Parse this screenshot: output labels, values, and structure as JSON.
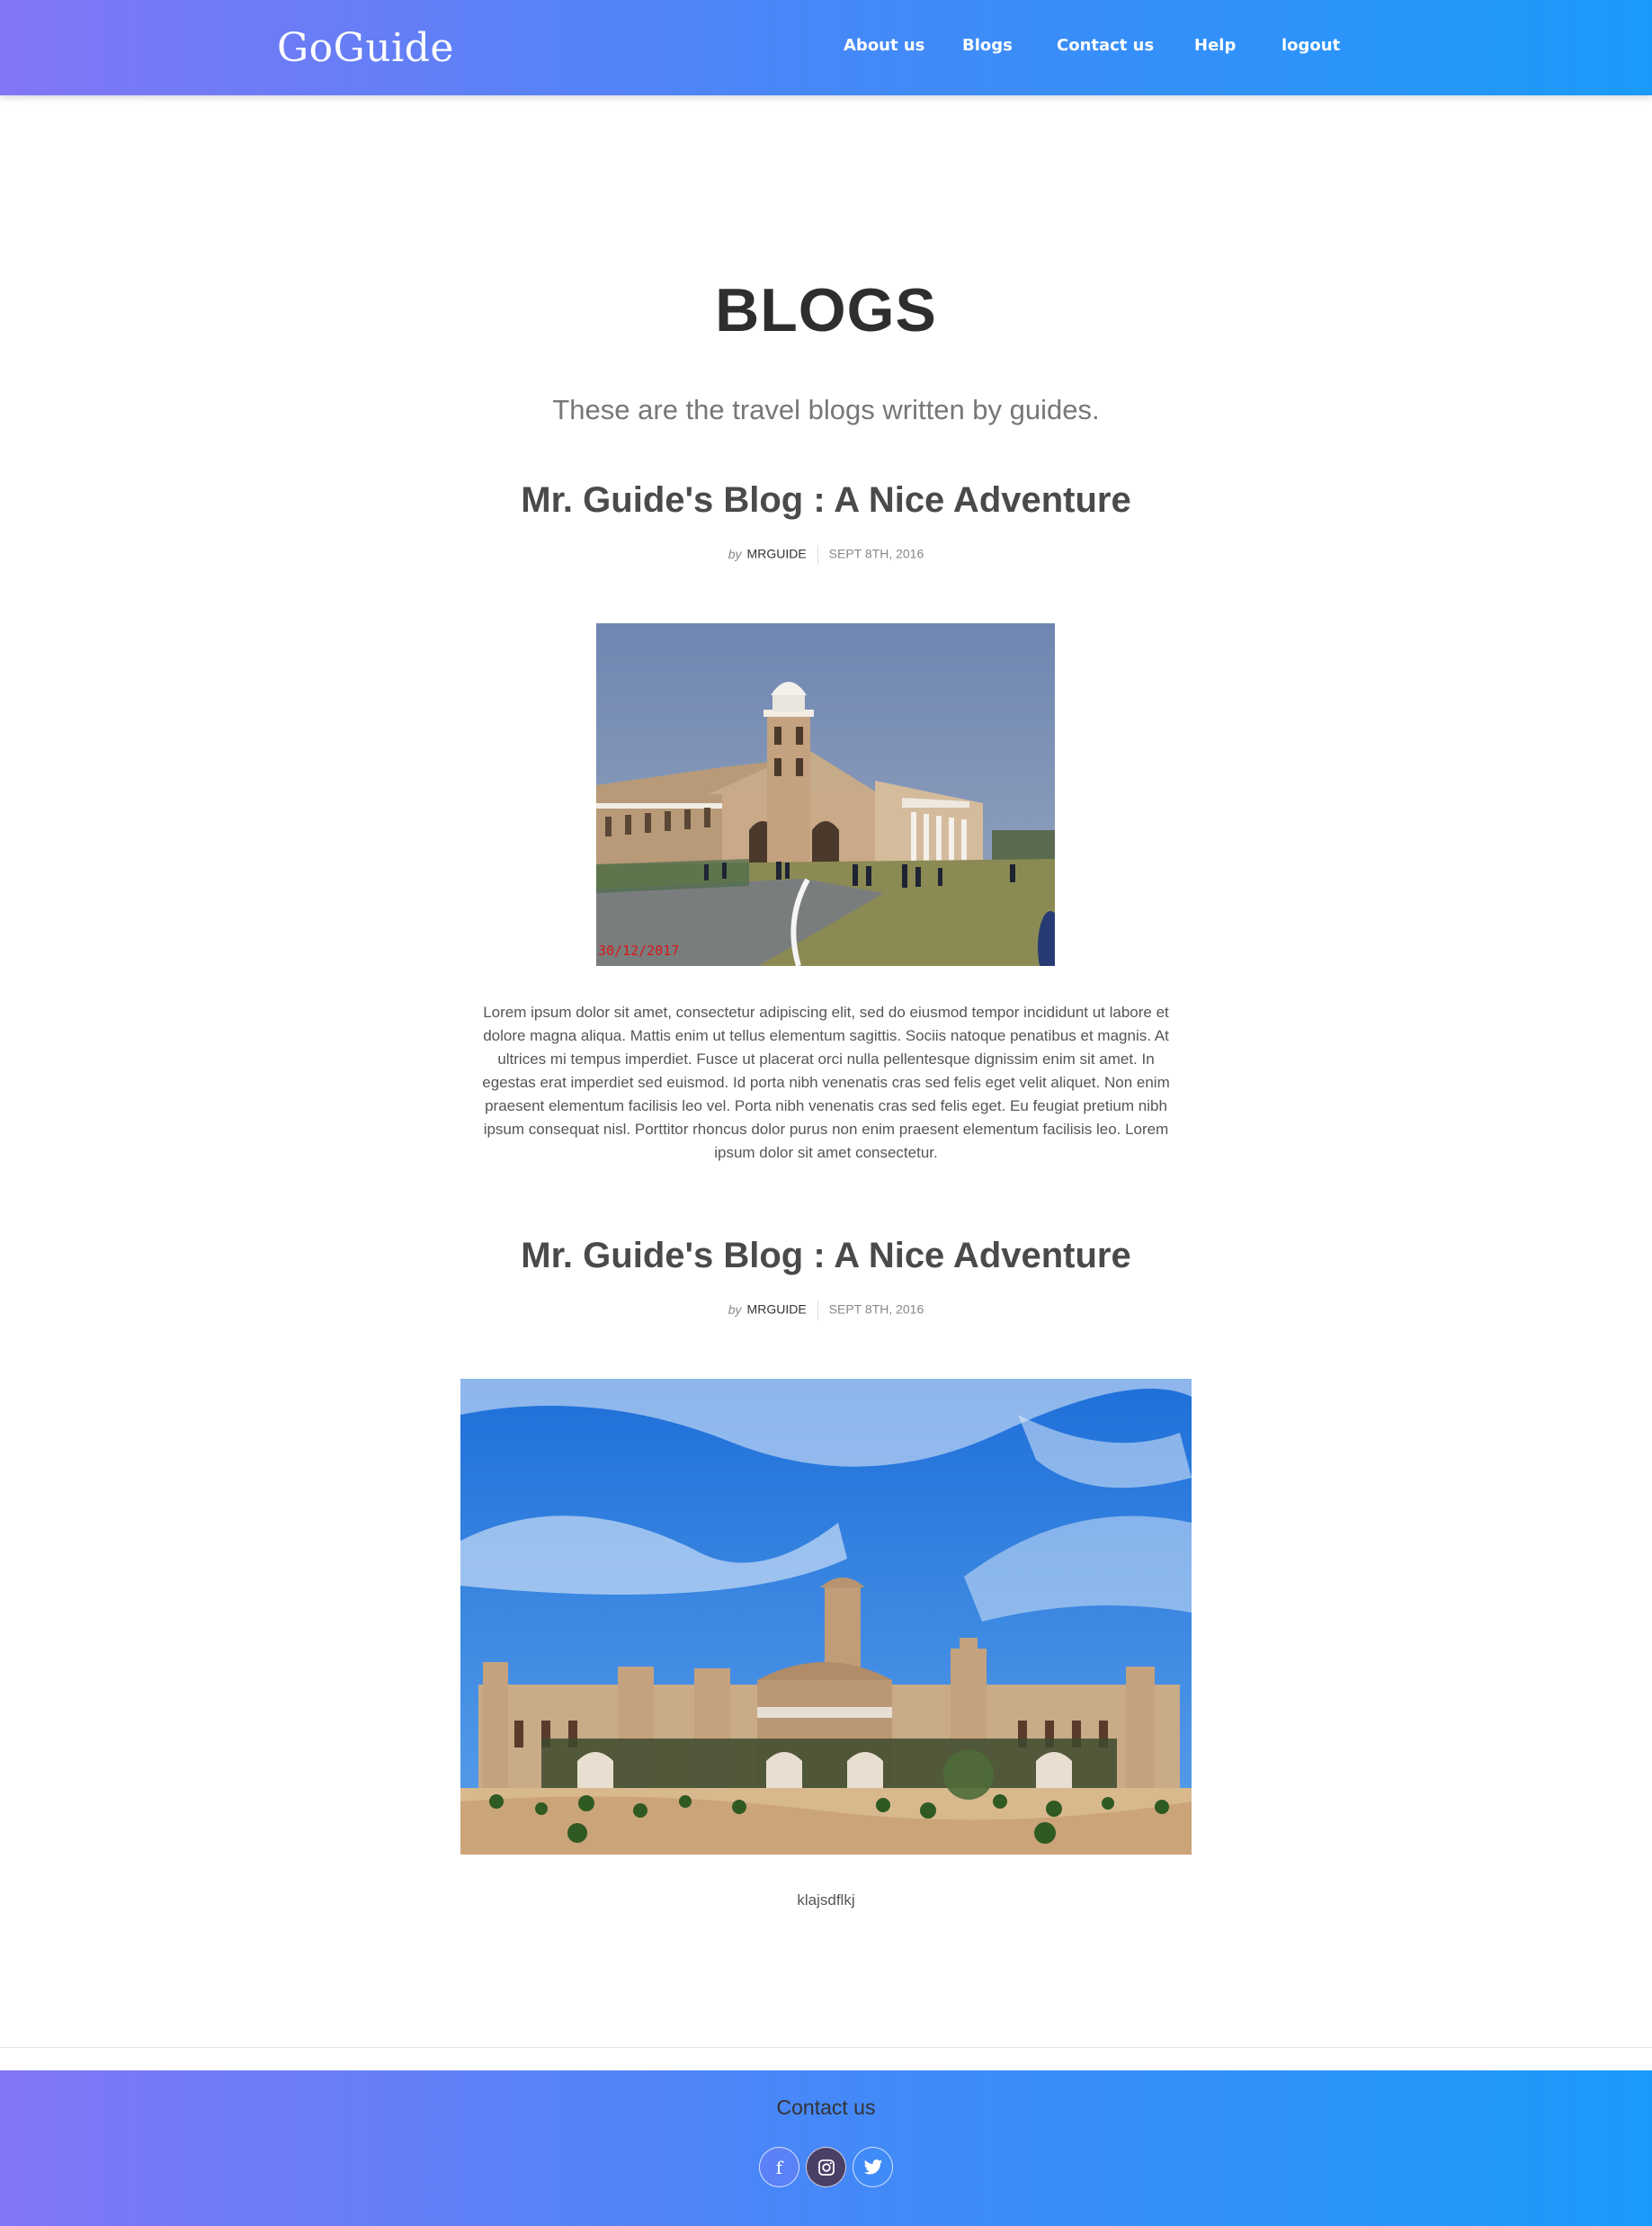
{
  "header": {
    "brand": "GoGuide",
    "nav": [
      {
        "label": "About us"
      },
      {
        "label": "Blogs"
      },
      {
        "label": "Contact us"
      },
      {
        "label": "Help"
      },
      {
        "label": "logout"
      }
    ]
  },
  "page": {
    "title": "BLOGS",
    "subtitle": "These are the travel blogs written by guides."
  },
  "posts": [
    {
      "title": "Mr. Guide's Blog : A Nice Adventure",
      "by": "by",
      "author": "MRGUIDE",
      "date": "SEPT 8TH, 2016",
      "image_stamp": "30/12/2017",
      "image_icon": "colonial-building-photo",
      "body": "Lorem ipsum dolor sit amet, consectetur adipiscing elit, sed do eiusmod tempor incididunt ut labore et dolore magna aliqua. Mattis enim ut tellus elementum sagittis. Sociis natoque penatibus et magnis. At ultrices mi tempus imperdiet. Fusce ut placerat orci nulla pellentesque dignissim enim sit amet. In egestas erat imperdiet sed euismod. Id porta nibh venenatis cras sed felis eget velit aliquet. Non enim praesent elementum facilisis leo vel. Porta nibh venenatis cras sed felis eget. Eu feugiat pretium nibh ipsum consequat nisl. Porttitor rhoncus dolor purus non enim praesent elementum facilisis leo. Lorem ipsum dolor sit amet consectetur."
    },
    {
      "title": "Mr. Guide's Blog : A Nice Adventure",
      "by": "by",
      "author": "MRGUIDE",
      "date": "SEPT 8TH, 2016",
      "image_icon": "palace-photo",
      "body": "klajsdflkj"
    }
  ],
  "footer": {
    "title": "Contact us",
    "social": [
      {
        "icon": "facebook-icon",
        "glyph": "f"
      },
      {
        "icon": "instagram-icon"
      },
      {
        "icon": "twitter-icon"
      }
    ]
  },
  "colors": {
    "gradient_start": "#8176f6",
    "gradient_end": "#1a9bfb",
    "instagram_bg": "#4a3f66"
  }
}
